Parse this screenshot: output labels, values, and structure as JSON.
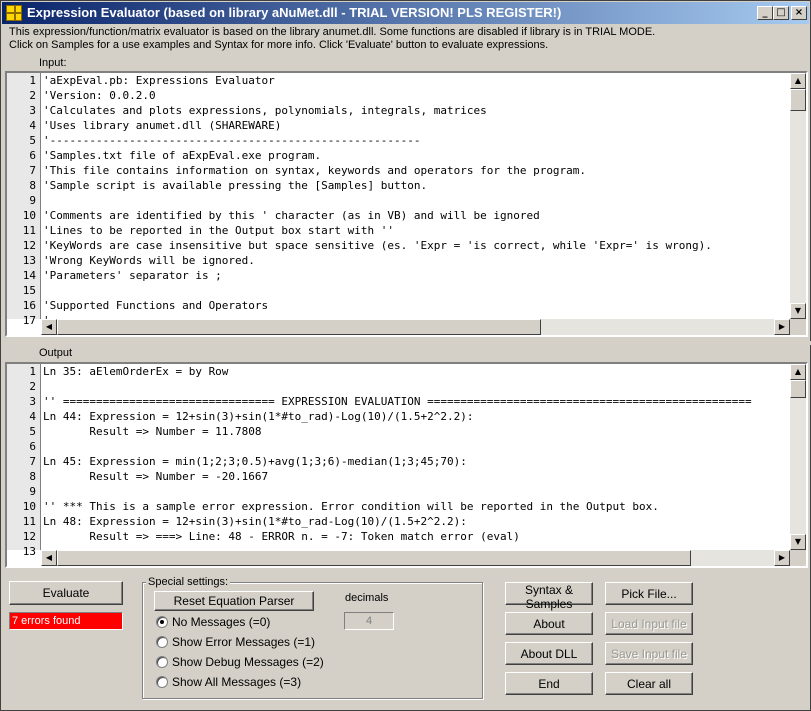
{
  "window": {
    "title": "Expression Evaluator (based on library aNuMet.dll - TRIAL VERSION! PLS REGISTER!)",
    "minimize_glyph": "_",
    "maximize_glyph": "□",
    "close_glyph": "×"
  },
  "info": {
    "line1": "This expression/function/matrix evaluator is based on the library anumet.dll. Some functions are disabled if library is in TRIAL MODE.",
    "line2": "Click on Samples for a use examples and Syntax for more info. Click 'Evaluate' button to evaluate expressions."
  },
  "input": {
    "label": "Input:",
    "line_numbers": [
      "1",
      "2",
      "3",
      "4",
      "5",
      "6",
      "7",
      "8",
      "9",
      "10",
      "11",
      "12",
      "13",
      "14",
      "15",
      "16",
      "17"
    ],
    "lines": [
      "'aExpEval.pb: Expressions Evaluator",
      "'Version: 0.0.2.0",
      "'Calculates and plots expressions, polynomials, integrals, matrices",
      "'Uses library anumet.dll (SHAREWARE)",
      "'--------------------------------------------------------",
      "'Samples.txt file of aExpEval.exe program.",
      "'This file contains information on syntax, keywords and operators for the program.",
      "'Sample script is available pressing the [Samples] button.",
      "",
      "'Comments are identified by this ' character (as in VB) and will be ignored",
      "'Lines to be reported in the Output box start with ''",
      "'KeyWords are case insensitive but space sensitive (es. 'Expr = 'is correct, while 'Expr=' is wrong).",
      "'Wrong KeyWords will be ignored.",
      "'Parameters' separator is ;",
      "",
      "'Supported Functions and Operators",
      "'----------------------------------"
    ]
  },
  "output": {
    "label": "Output",
    "line_numbers": [
      "1",
      "2",
      "3",
      "4",
      "5",
      "6",
      "7",
      "8",
      "9",
      "10",
      "11",
      "12",
      "13"
    ],
    "lines": [
      "Ln 35: aElemOrderEx = by Row",
      "",
      "'' ================================ EXPRESSION EVALUATION =================================================",
      "Ln 44: Expression = 12+sin(3)+sin(1*#to_rad)-Log(10)/(1.5+2^2.2):",
      "       Result => Number = 11.7808",
      "",
      "Ln 45: Expression = min(1;2;3;0.5)+avg(1;3;6)-median(1;3;45;70):",
      "       Result => Number = -20.1667",
      "",
      "'' *** This is a sample error expression. Error condition will be reported in the Output box.",
      "Ln 48: Expression = 12+sin(3)+sin(1*#to_rad-Log(10)/(1.5+2^2.2):",
      "       Result => ===> Line: 48 - ERROR n. = -7: Token match error (eval)",
      ""
    ]
  },
  "controls": {
    "evaluate_label": "Evaluate",
    "error_status": "7 errors found",
    "special_settings_title": "Special settings:",
    "reset_parser_label": "Reset Equation Parser",
    "decimals_label": "decimals",
    "decimals_value": "4",
    "radios": [
      {
        "label": "No Messages (=0)",
        "checked": true
      },
      {
        "label": "Show Error Messages (=1)",
        "checked": false
      },
      {
        "label": "Show Debug Messages (=2)",
        "checked": false
      },
      {
        "label": "Show All Messages (=3)",
        "checked": false
      }
    ],
    "syntax_samples_label": "Syntax & Samples",
    "pick_file_label": "Pick File...",
    "about_label": "About",
    "load_input_label": "Load Input file",
    "about_dll_label": "About DLL",
    "save_input_label": "Save Input file",
    "end_label": "End",
    "clear_all_label": "Clear all"
  },
  "colors": {
    "error_bg": "#ff0000",
    "title_start": "#0a246a",
    "title_end": "#a6caf0"
  }
}
